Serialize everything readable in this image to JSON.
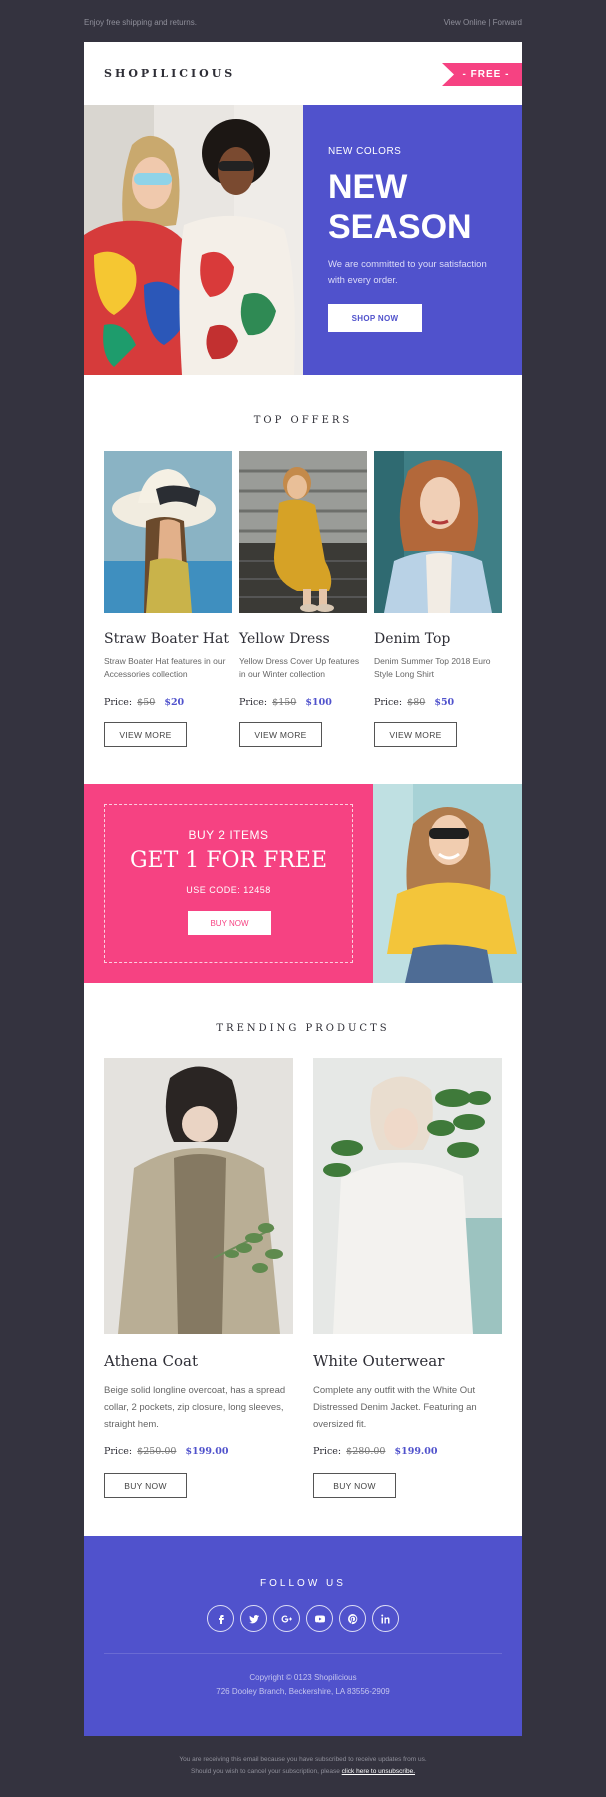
{
  "preheader": {
    "left_text": "Enjoy free shipping and returns.",
    "view_online": "View Online",
    "separator": "|",
    "forward": "Forward"
  },
  "header": {
    "logo": "SHOPILICIOUS",
    "badge": "- FREE -"
  },
  "hero": {
    "kicker": "NEW COLORS",
    "title": "NEW SEASON",
    "text": "We are committed to your satisfaction with every order.",
    "button": "SHOP NOW"
  },
  "offers": {
    "title": "TOP OFFERS",
    "items": [
      {
        "name": "Straw Boater Hat",
        "desc": "Straw Boater Hat features in our Accessories collection",
        "price_label": "Price:",
        "old_price": "$50",
        "new_price": "$20",
        "button": "VIEW MORE"
      },
      {
        "name": "Yellow Dress",
        "desc": "Yellow Dress Cover Up features in our Winter collection",
        "price_label": "Price:",
        "old_price": "$150",
        "new_price": "$100",
        "button": "VIEW MORE"
      },
      {
        "name": "Denim Top",
        "desc": "Denim Summer Top 2018 Euro Style Long Shirt",
        "price_label": "Price:",
        "old_price": "$80",
        "new_price": "$50",
        "button": "VIEW MORE"
      }
    ]
  },
  "promo": {
    "kicker": "BUY 2 ITEMS",
    "title": "GET 1 FOR FREE",
    "code": "USE CODE: 12458",
    "button": "BUY NOW"
  },
  "trending": {
    "title": "TRENDING PRODUCTS",
    "items": [
      {
        "name": "Athena Coat",
        "desc": "Beige solid longline overcoat, has a spread collar, 2 pockets, zip closure, long sleeves, straight hem.",
        "price_label": "Price:",
        "old_price": "$250.00",
        "new_price": "$199.00",
        "button": "BUY NOW"
      },
      {
        "name": "White Outerwear",
        "desc": "Complete any outfit with the White Out Distressed Denim Jacket. Featuring an oversized fit.",
        "price_label": "Price:",
        "old_price": "$280.00",
        "new_price": "$199.00",
        "button": "BUY NOW"
      }
    ]
  },
  "footer": {
    "follow": "FOLLOW US",
    "socials": [
      "facebook-icon",
      "twitter-icon",
      "google-plus-icon",
      "youtube-icon",
      "pinterest-icon",
      "linkedin-icon"
    ],
    "copyright": "Copyright © 0123 Shopilicious",
    "address": "726 Dooley Branch, Beckershire, LA 83556-2909"
  },
  "postfooter": {
    "line1": "You are receiving this email because you have subscribed to receive updates from us.",
    "line2": "Should you wish to cancel your subscription, please",
    "unsubscribe": "click here to unsubscribe."
  },
  "colors": {
    "background": "#34333f",
    "brand_purple": "#5052cc",
    "brand_pink": "#f64282"
  }
}
